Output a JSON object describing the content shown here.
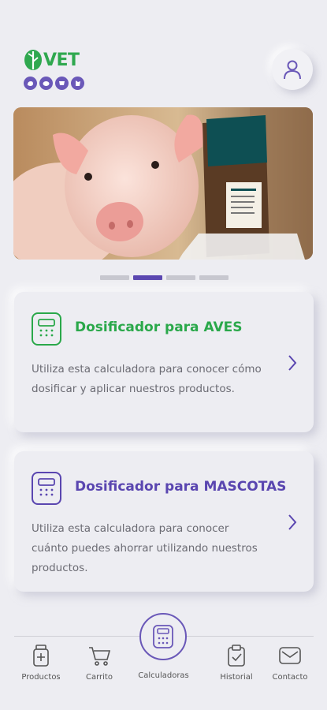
{
  "brand": {
    "logo_text": "VET",
    "logo_color": "#2fa84f",
    "species_icons": [
      "chicken-icon",
      "pig-icon",
      "cow-icon",
      "dog-icon"
    ]
  },
  "header": {
    "profile_icon": "user-icon"
  },
  "banner": {
    "slides_count": 4,
    "active_slide": 2,
    "image": "pig-with-feed-bag"
  },
  "cards": [
    {
      "title": "Dosificador para AVES",
      "description": "Utiliza esta calculadora para conocer cómo dosificar y aplicar nuestros productos.",
      "accent": "#2aa84a",
      "icon": "calculator-icon"
    },
    {
      "title": "Dosificador para MASCOTAS",
      "description": "Utiliza esta calculadora para conocer cuánto puedes ahorrar utilizando nuestros productos.",
      "accent": "#5a46b0",
      "icon": "calculator-icon"
    }
  ],
  "nav": {
    "items": [
      {
        "label": "Productos",
        "icon": "medicine-bottle-icon"
      },
      {
        "label": "Carrito",
        "icon": "cart-icon"
      },
      {
        "label": "Calculadoras",
        "icon": "calculator-icon"
      },
      {
        "label": "Historial",
        "icon": "clipboard-icon"
      },
      {
        "label": "Contacto",
        "icon": "mail-icon"
      }
    ],
    "active": "Calculadoras",
    "active_color": "#6a58b8"
  }
}
